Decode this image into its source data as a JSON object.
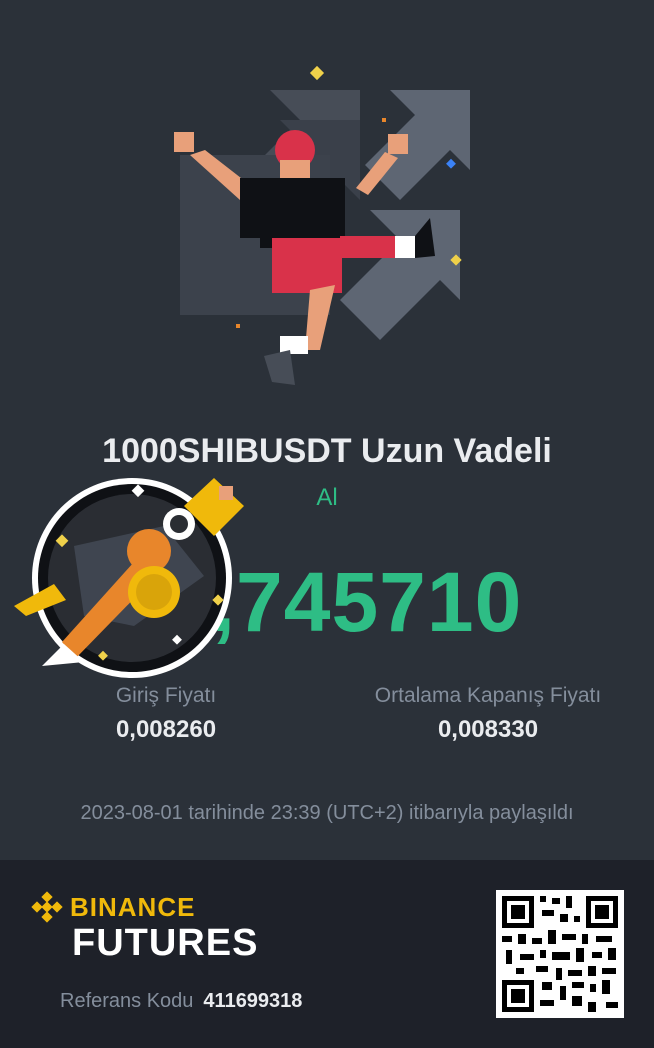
{
  "position": {
    "pair": "1000SHIBUSDT Uzun Vadeli",
    "side": "Al",
    "roi": ",745710"
  },
  "prices": {
    "entry_label": "Giriş Fiyatı",
    "entry_value": "0,008260",
    "close_label": "Ortalama Kapanış Fiyatı",
    "close_value": "0,008330"
  },
  "shared_text": "2023-08-01 tarihinde 23:39 (UTC+2) itibarıyla paylaşıldı",
  "footer": {
    "brand_name": "BINANCE",
    "brand_sub": "FUTURES",
    "ref_label": "Referans Kodu",
    "ref_code": "411699318"
  },
  "colors": {
    "positive": "#2ebd85",
    "brand": "#f0b90b",
    "background": "#2b3139",
    "footer": "#1e2129"
  },
  "icons": {
    "hero": "jumping-person-arrows-illustration",
    "badge": "rocket-badge-icon",
    "logo": "binance-logo-icon",
    "qr": "qr-code-icon"
  }
}
